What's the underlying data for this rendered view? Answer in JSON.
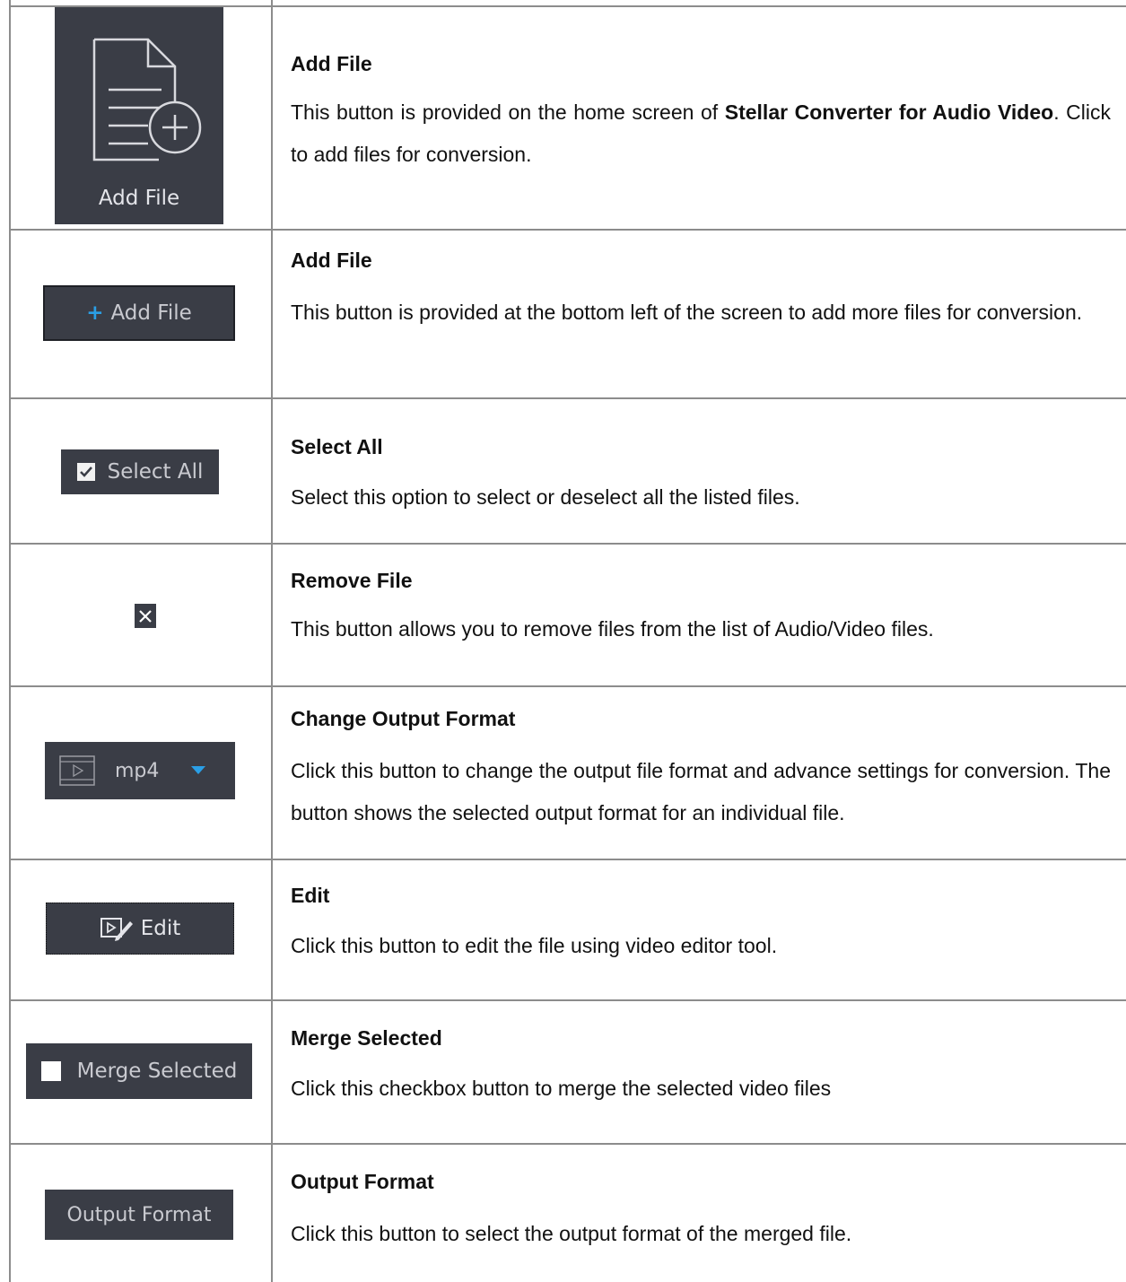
{
  "rows": [
    {
      "button_label": "Add File",
      "title": "Add File",
      "desc_pre": "This button is provided on the home screen of ",
      "desc_bold": "Stellar Converter for Audio Video",
      "desc_post": ". Click to add files for conversion.",
      "icon": "add-file-document-icon"
    },
    {
      "button_label": "Add File",
      "button_prefix": "+",
      "title": "Add File",
      "desc": "This button is provided at the bottom left of the screen to add more files for conversion.",
      "icon": "plus-icon"
    },
    {
      "button_label": "Select All",
      "title": "Select All",
      "desc": "Select this option to select or deselect all the listed files.",
      "icon": "checkbox-checked-icon"
    },
    {
      "title": "Remove File",
      "desc": "This button allows you to remove files from the list of Audio/Video files.",
      "icon": "close-icon"
    },
    {
      "button_label": "mp4",
      "title": "Change Output Format",
      "desc": "Click this button to change the output file format and advance settings for conversion. The button shows the selected output format for an individual file.",
      "icon": "film-icon"
    },
    {
      "button_label": "Edit",
      "title": "Edit",
      "desc": "Click this button to edit the file using video editor tool.",
      "icon": "edit-video-icon"
    },
    {
      "button_label": "Merge Selected",
      "title": "Merge Selected",
      "desc": "Click this checkbox button to merge the selected video files",
      "icon": "checkbox-empty-icon"
    },
    {
      "button_label": "Output Format",
      "title": "Output Format",
      "desc": "Click this button to select the output format of the merged file."
    }
  ],
  "colors": {
    "button_bg": "#3a3d46",
    "button_text": "#c9cad0",
    "accent_blue": "#2a9fe6",
    "border": "#8c8c8c"
  }
}
